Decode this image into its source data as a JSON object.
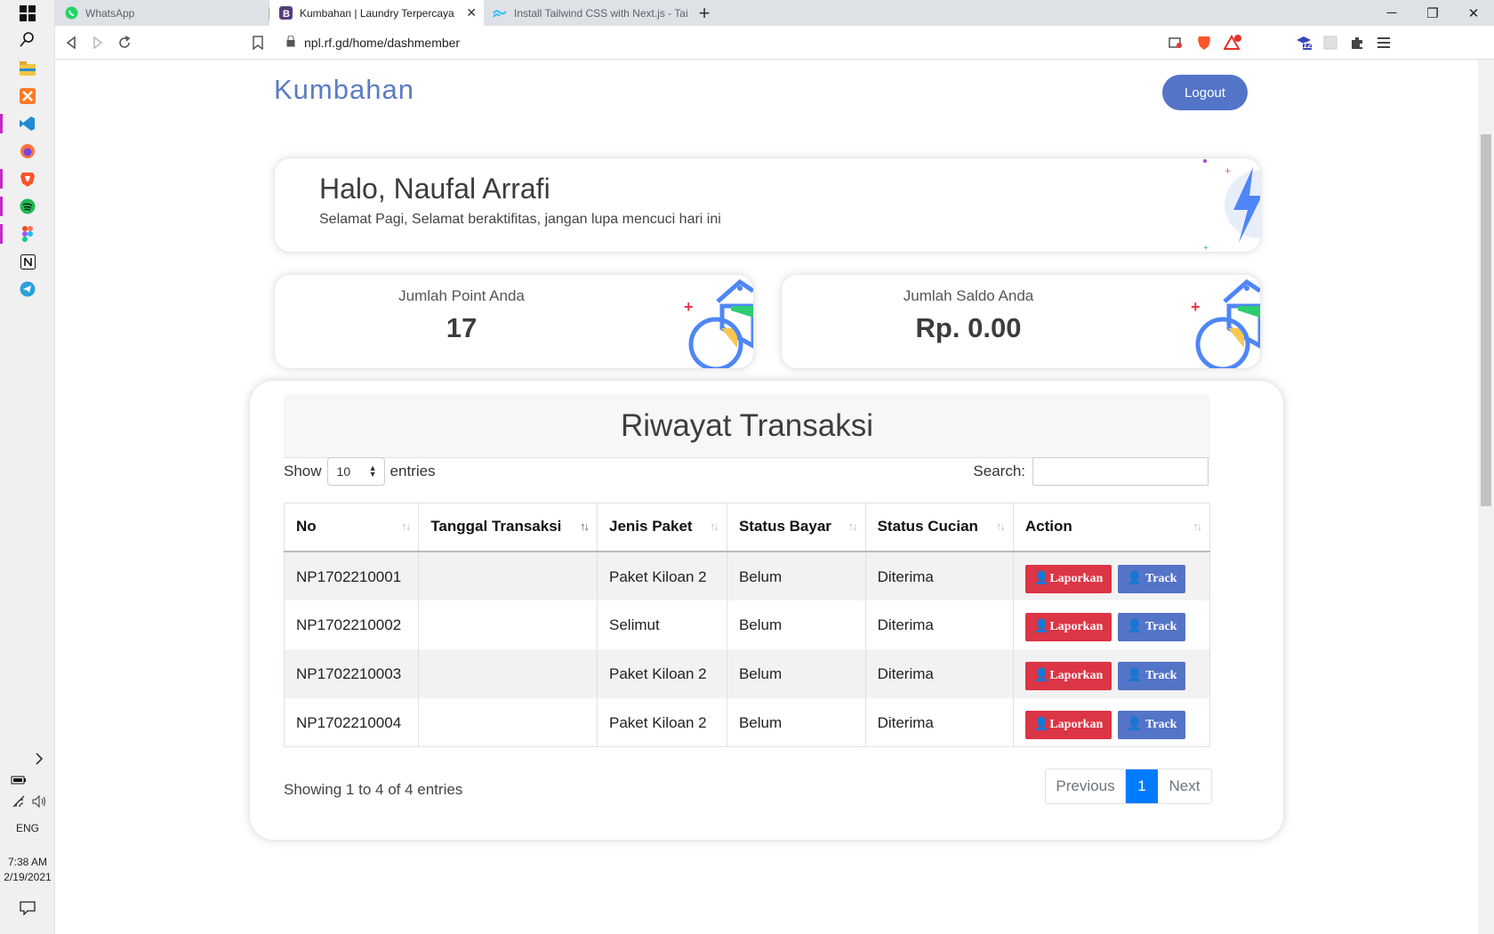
{
  "taskbar": {
    "lang": "ENG",
    "time": "7:38 AM",
    "date": "2/19/2021"
  },
  "browser": {
    "tabs": [
      {
        "title": "WhatsApp"
      },
      {
        "title": "Kumbahan | Laundry Terpercaya"
      },
      {
        "title": "Install Tailwind CSS with Next.js - Tailw"
      }
    ],
    "url": "npl.rf.gd/home/dashmember",
    "extension_badge": "12",
    "brave_badge": "1"
  },
  "page": {
    "brand": "Kumbahan",
    "logout_label": "Logout",
    "greeting_title": "Halo, Naufal Arrafi",
    "greeting_subtitle": "Selamat Pagi, Selamat beraktifitas, jangan lupa mencuci hari ini",
    "points_label": "Jumlah Point Anda",
    "points_value": "17",
    "saldo_label": "Jumlah Saldo Anda",
    "saldo_value": "Rp. 0.00",
    "table_title": "Riwayat Transaksi",
    "show_label": "Show",
    "entries_label": "entries",
    "page_length": "10",
    "search_label": "Search:",
    "columns": [
      "No",
      "Tanggal Transaksi",
      "Jenis Paket",
      "Status Bayar",
      "Status Cucian",
      "Action"
    ],
    "rows": [
      {
        "no": "NP1702210001",
        "tanggal": "",
        "paket": "Paket Kiloan 2",
        "bayar": "Belum",
        "cucian": "Diterima"
      },
      {
        "no": "NP1702210002",
        "tanggal": "",
        "paket": "Selimut",
        "bayar": "Belum",
        "cucian": "Diterima"
      },
      {
        "no": "NP1702210003",
        "tanggal": "",
        "paket": "Paket Kiloan 2",
        "bayar": "Belum",
        "cucian": "Diterima"
      },
      {
        "no": "NP1702210004",
        "tanggal": "",
        "paket": "Paket Kiloan 2",
        "bayar": "Belum",
        "cucian": "Diterima"
      }
    ],
    "action_report": "Laporkan",
    "action_track": "Track",
    "info": "Showing 1 to 4 of 4 entries",
    "pager": {
      "prev": "Previous",
      "current": "1",
      "next": "Next"
    }
  },
  "colors": {
    "brand": "#5b7cc4",
    "primary": "#5474c8",
    "danger": "#dc3545",
    "page_active": "#007bff"
  }
}
